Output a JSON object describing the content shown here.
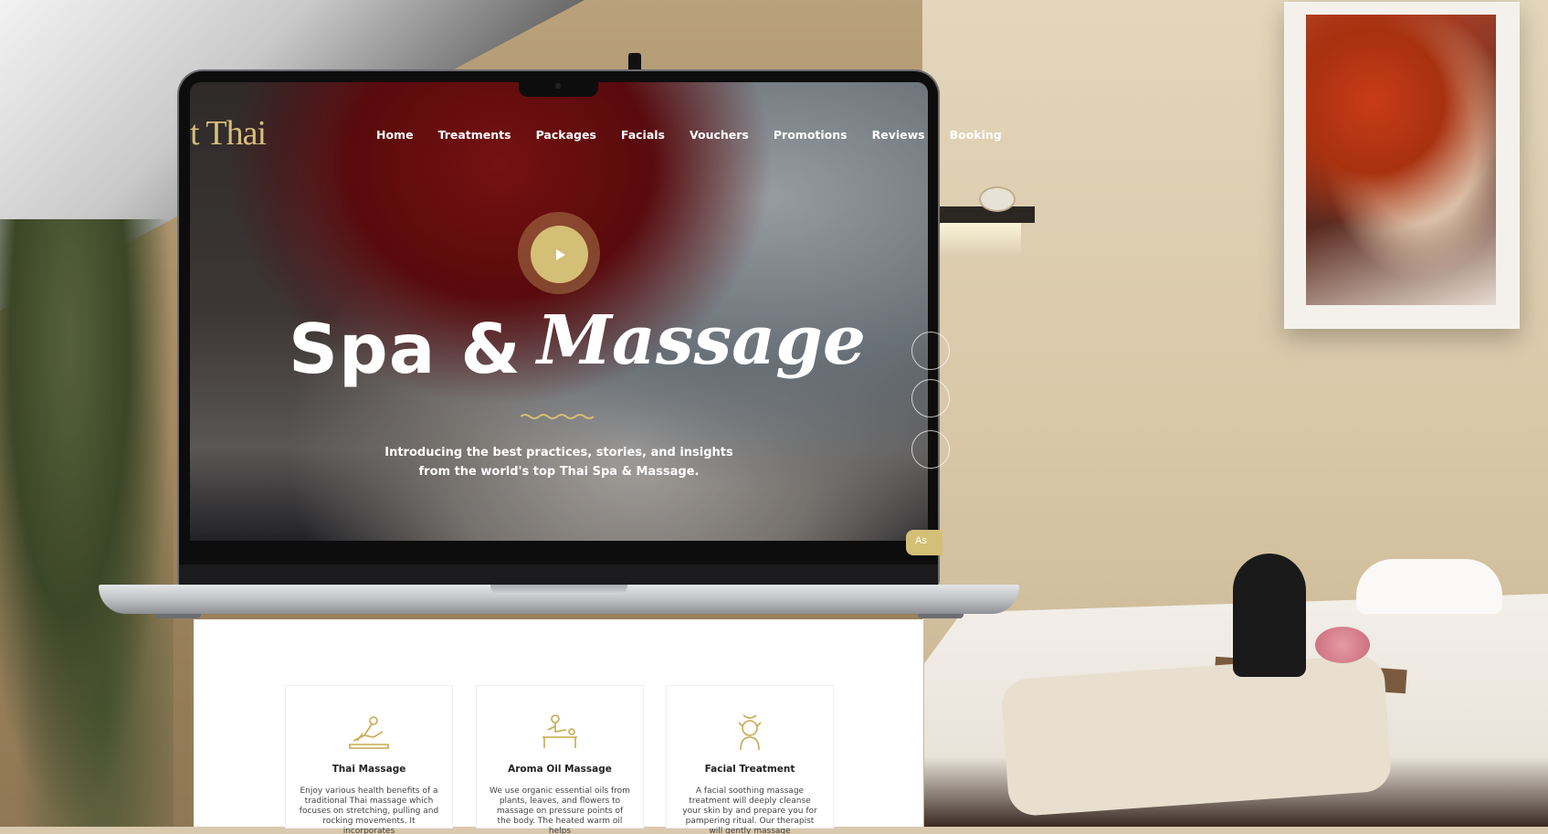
{
  "site": {
    "logo_text": "t Thai",
    "nav": [
      "Home",
      "Treatments",
      "Packages",
      "Facials",
      "Vouchers",
      "Promotions",
      "Reviews",
      "Booking"
    ]
  },
  "hero": {
    "title_main": "Spa &",
    "title_italic": "Massage",
    "subtitle": "Introducing the best practices, stories, and insights from the world's top Thai Spa & Massage.",
    "play_icon": "play-icon",
    "ask_label": "As"
  },
  "services": [
    {
      "icon": "thai-massage-icon",
      "title": "Thai Massage",
      "description": "Enjoy various health benefits of a traditional Thai massage which focuses on stretching, pulling and rocking movements. It incorporates"
    },
    {
      "icon": "aroma-oil-massage-icon",
      "title": "Aroma Oil Massage",
      "description": "We use organic essential oils from plants, leaves, and flowers to massage on pressure points of the body. The heated warm oil helps"
    },
    {
      "icon": "facial-treatment-icon",
      "title": "Facial Treatment",
      "description": "A facial soothing massage treatment will deeply cleanse your skin by and prepare you for pampering ritual. Our therapist will gently massage"
    }
  ],
  "colors": {
    "accent": "#d4bf76",
    "text": "#ffffff"
  }
}
